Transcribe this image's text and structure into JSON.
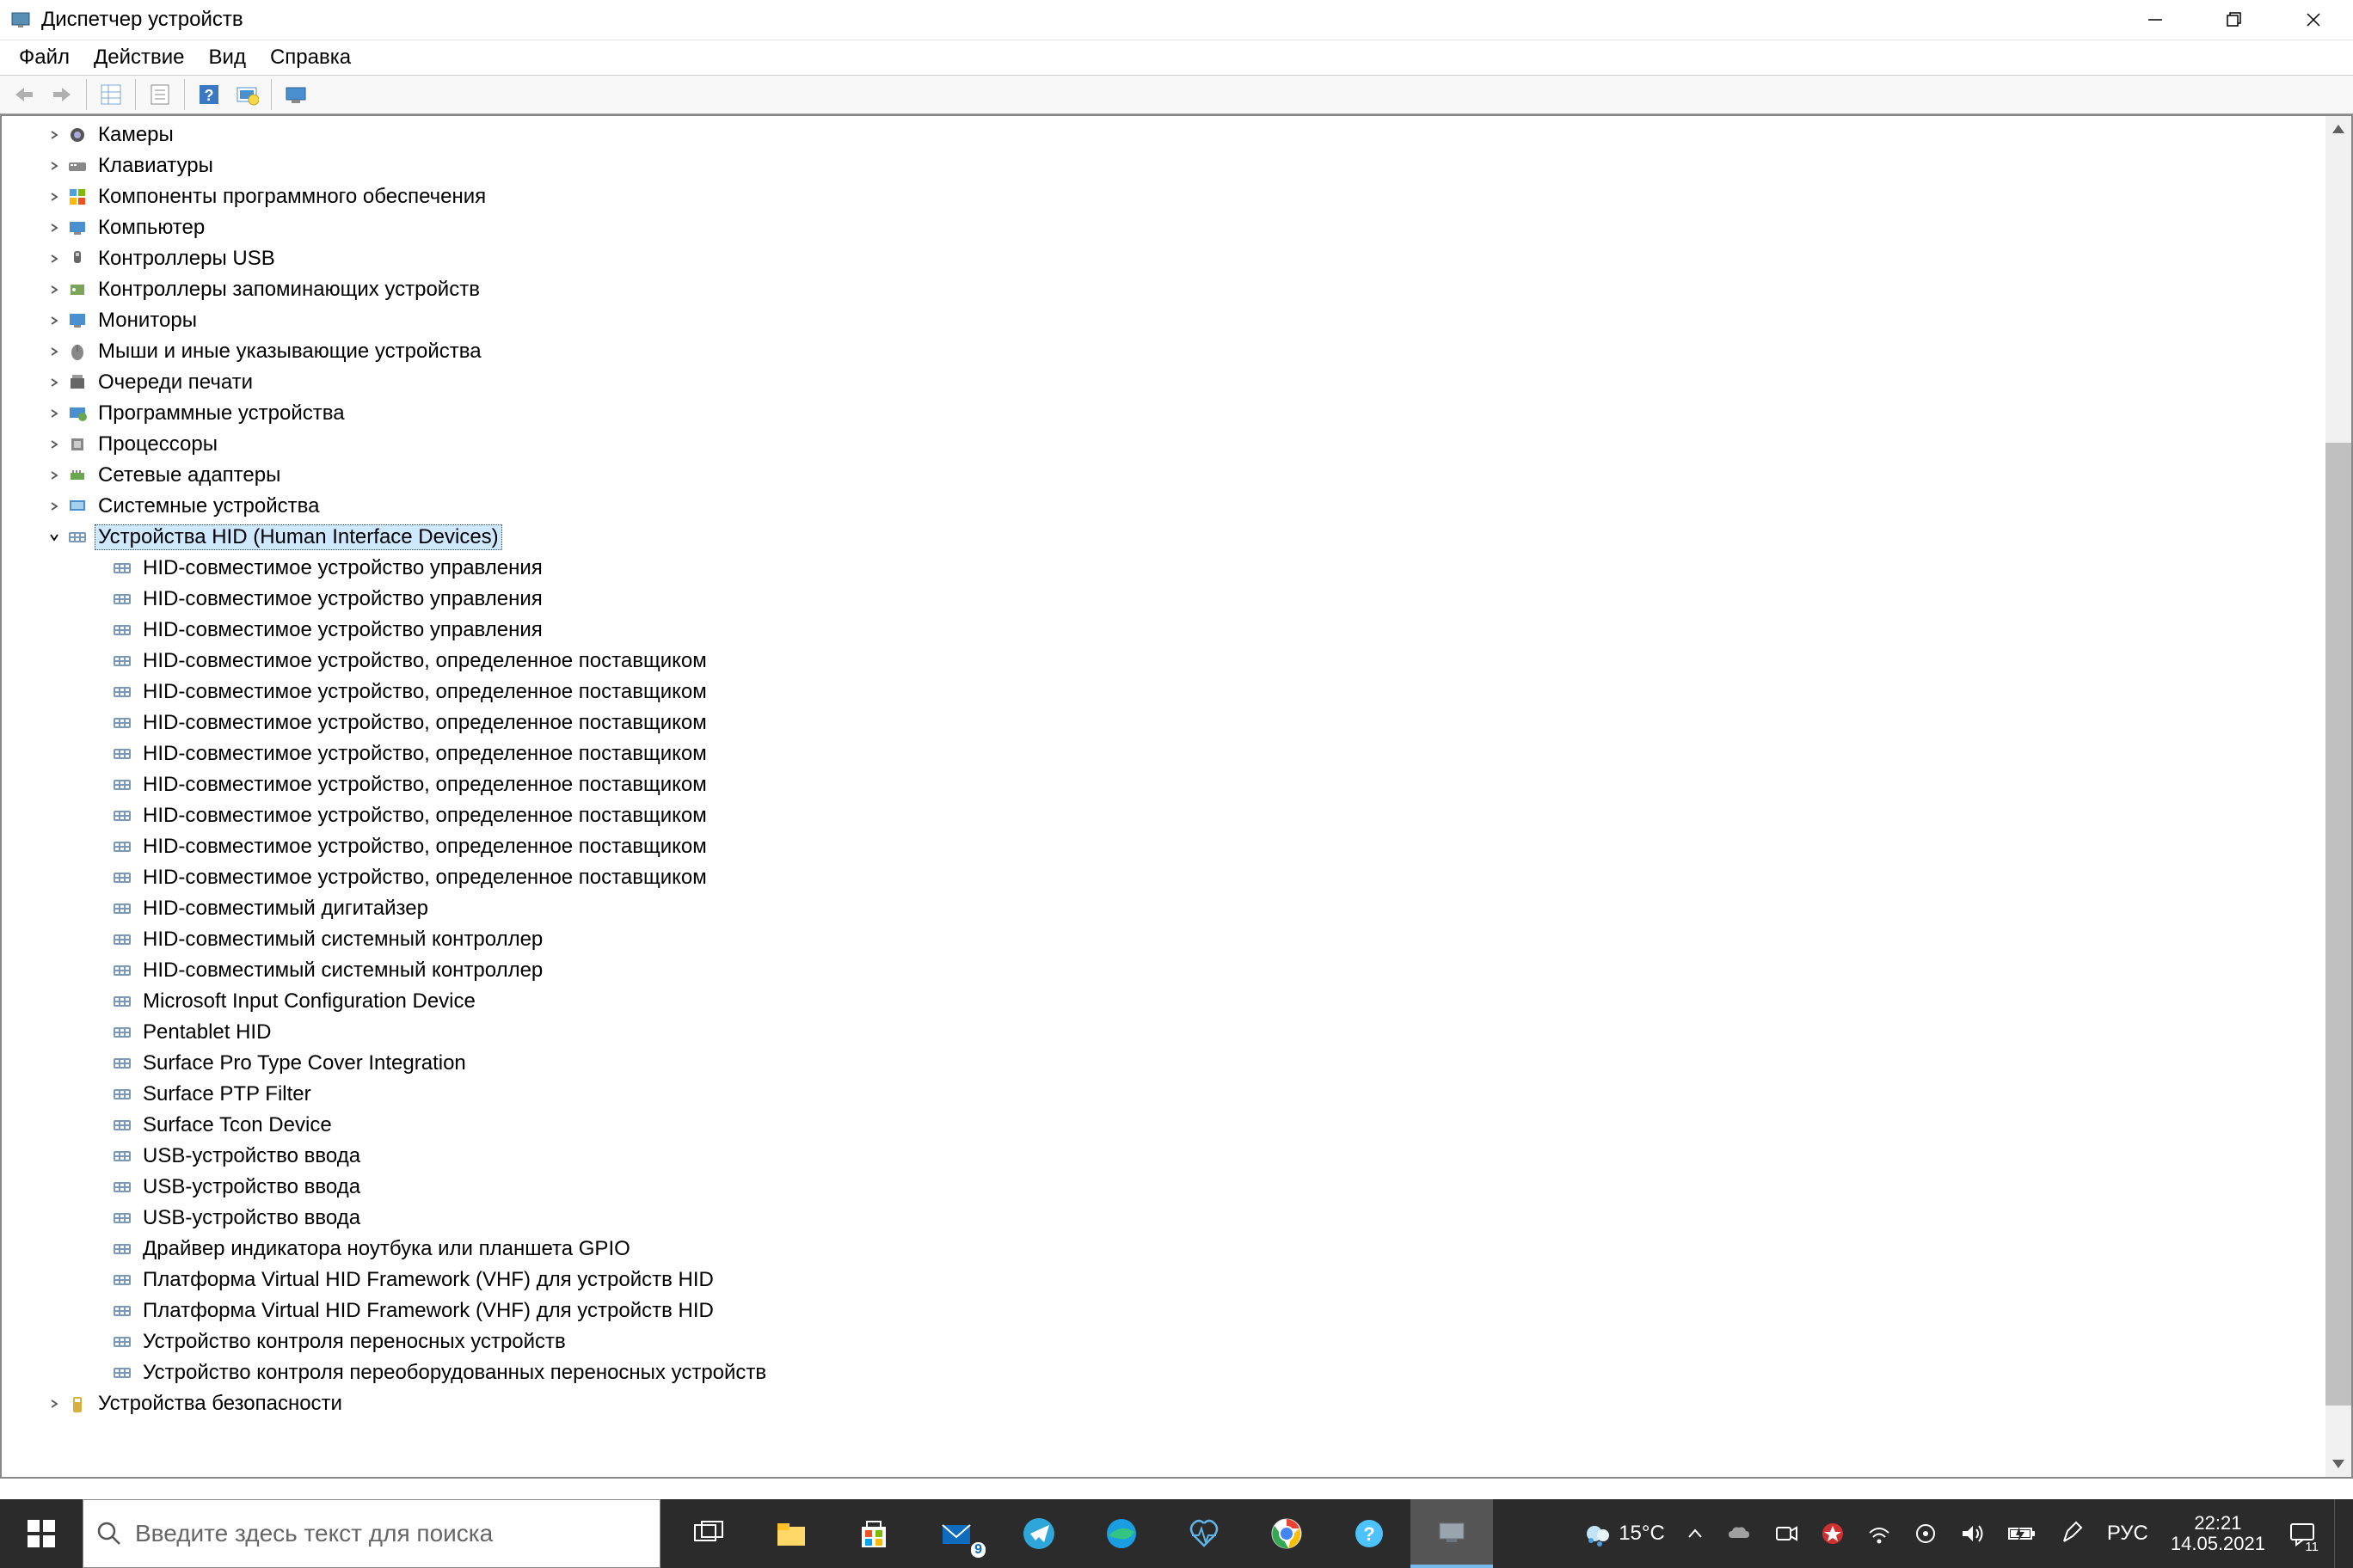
{
  "window": {
    "title": "Диспетчер устройств"
  },
  "menu": {
    "file": "Файл",
    "action": "Действие",
    "view": "Вид",
    "help": "Справка"
  },
  "tree": {
    "categories": [
      {
        "label": "Камеры"
      },
      {
        "label": "Клавиатуры"
      },
      {
        "label": "Компоненты программного обеспечения"
      },
      {
        "label": "Компьютер"
      },
      {
        "label": "Контроллеры USB"
      },
      {
        "label": "Контроллеры запоминающих устройств"
      },
      {
        "label": "Мониторы"
      },
      {
        "label": "Мыши и иные указывающие устройства"
      },
      {
        "label": "Очереди печати"
      },
      {
        "label": "Программные устройства"
      },
      {
        "label": "Процессоры"
      },
      {
        "label": "Сетевые адаптеры"
      },
      {
        "label": "Системные устройства"
      }
    ],
    "expanded": {
      "label": "Устройства HID (Human Interface Devices)"
    },
    "hid_children": [
      {
        "label": "HID-совместимое устройство управления"
      },
      {
        "label": "HID-совместимое устройство управления"
      },
      {
        "label": "HID-совместимое устройство управления"
      },
      {
        "label": "HID-совместимое устройство, определенное поставщиком"
      },
      {
        "label": "HID-совместимое устройство, определенное поставщиком"
      },
      {
        "label": "HID-совместимое устройство, определенное поставщиком"
      },
      {
        "label": "HID-совместимое устройство, определенное поставщиком"
      },
      {
        "label": "HID-совместимое устройство, определенное поставщиком"
      },
      {
        "label": "HID-совместимое устройство, определенное поставщиком"
      },
      {
        "label": "HID-совместимое устройство, определенное поставщиком"
      },
      {
        "label": "HID-совместимое устройство, определенное поставщиком"
      },
      {
        "label": "HID-совместимый дигитайзер"
      },
      {
        "label": "HID-совместимый системный контроллер"
      },
      {
        "label": "HID-совместимый системный контроллер"
      },
      {
        "label": "Microsoft Input Configuration Device"
      },
      {
        "label": "Pentablet HID"
      },
      {
        "label": "Surface Pro Type Cover Integration"
      },
      {
        "label": "Surface PTP Filter"
      },
      {
        "label": "Surface Tcon Device"
      },
      {
        "label": "USB-устройство ввода"
      },
      {
        "label": "USB-устройство ввода"
      },
      {
        "label": "USB-устройство ввода"
      },
      {
        "label": "Драйвер индикатора ноутбука или планшета GPIO"
      },
      {
        "label": "Платформа Virtual HID Framework (VHF)  для устройств HID"
      },
      {
        "label": "Платформа Virtual HID Framework (VHF)  для устройств HID"
      },
      {
        "label": "Устройство контроля переносных устройств"
      },
      {
        "label": "Устройство контроля переоборудованных переносных устройств"
      }
    ],
    "last": {
      "label": "Устройства безопасности"
    }
  },
  "taskbar": {
    "search_placeholder": "Введите здесь текст для поиска",
    "weather_temp": "15°C",
    "mail_badge": "9",
    "lang": "РУС",
    "time": "22:21",
    "date": "14.05.2021",
    "notif_badge": "11"
  }
}
